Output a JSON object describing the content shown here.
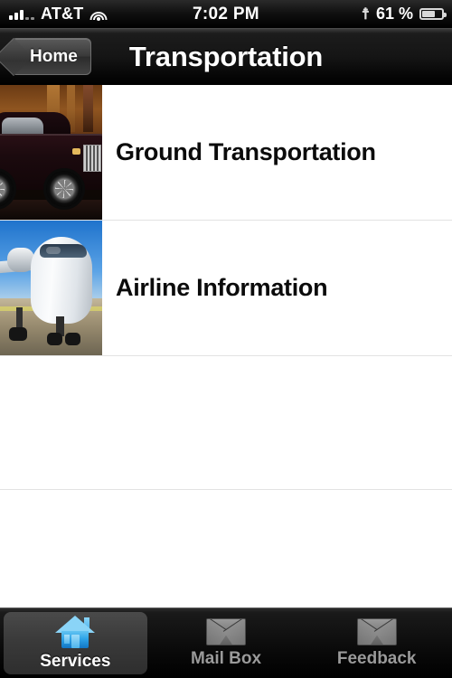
{
  "status_bar": {
    "signal_icon": "signal-bars-icon",
    "signal_bars_filled": 3,
    "signal_bars_total": 5,
    "carrier": "AT&T",
    "wifi_icon": "wifi-icon",
    "time": "7:02 PM",
    "bluetooth_icon": "bluetooth-icon",
    "battery_percent": "61 %",
    "battery_level": 61,
    "battery_icon": "battery-icon"
  },
  "nav_bar": {
    "back_label": "Home",
    "back_icon": "back-chevron-icon",
    "title": "Transportation"
  },
  "list": {
    "rows": [
      {
        "label": "Ground Transportation",
        "thumbnail": "luxury-car-photo"
      },
      {
        "label": "Airline Information",
        "thumbnail": "airplane-photo"
      }
    ]
  },
  "tab_bar": {
    "tabs": [
      {
        "label": "Services",
        "icon": "home-house-icon",
        "active": true
      },
      {
        "label": "Mail Box",
        "icon": "envelope-icon",
        "active": false
      },
      {
        "label": "Feedback",
        "icon": "envelope-icon",
        "active": false
      }
    ]
  },
  "colors": {
    "accent_blue": "#2ea4e8",
    "nav_background": "#151515",
    "list_background": "#ffffff",
    "separator": "#e2e2e2",
    "active_tab_label": "#ffffff",
    "inactive_tab_label": "#9a9a9a"
  }
}
